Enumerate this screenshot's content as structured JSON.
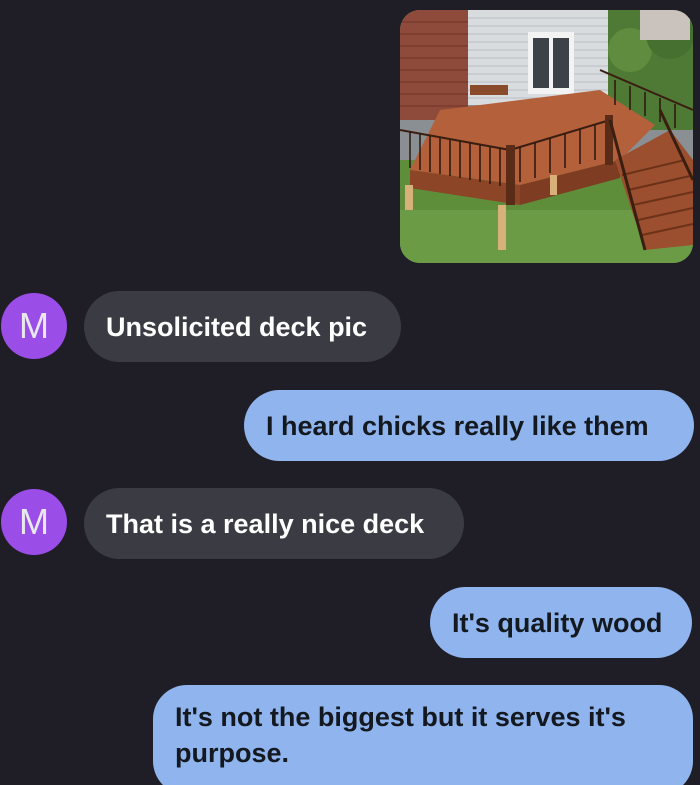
{
  "thread": {
    "contact_initial": "M",
    "colors": {
      "background": "#1f1e26",
      "incoming_bubble": "#3b3b43",
      "outgoing_bubble": "#8fb4ee",
      "avatar": "#9b4de8"
    },
    "messages": [
      {
        "direction": "incoming",
        "type": "image",
        "icon": "deck-photo"
      },
      {
        "direction": "incoming",
        "type": "text",
        "text": "Unsolicited deck pic"
      },
      {
        "direction": "outgoing",
        "type": "text",
        "text": "I heard chicks really like them"
      },
      {
        "direction": "incoming",
        "type": "text",
        "text": "That is a really nice deck"
      },
      {
        "direction": "outgoing",
        "type": "text",
        "text": "It's quality wood"
      },
      {
        "direction": "outgoing",
        "type": "text",
        "text": "It's not the biggest but it serves it's purpose."
      }
    ]
  }
}
